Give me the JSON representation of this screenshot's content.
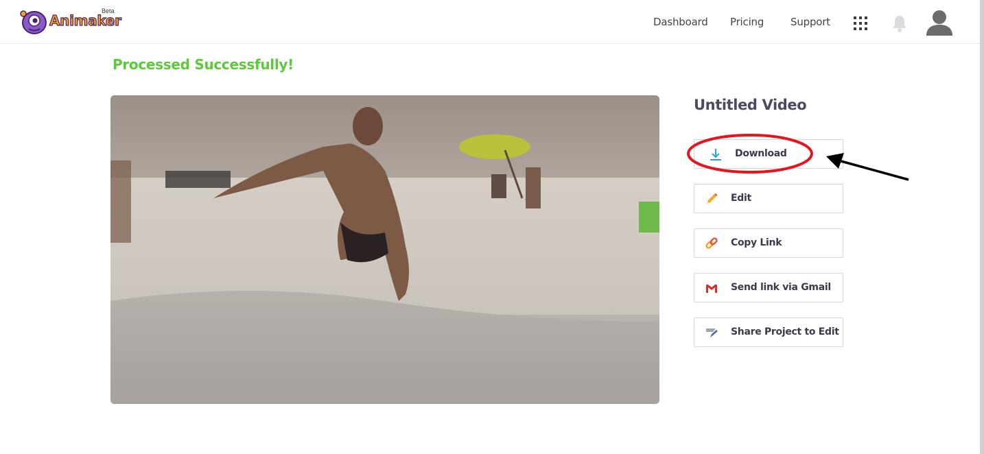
{
  "header": {
    "logo_text": "Animaker",
    "logo_badge": "Beta",
    "nav": [
      {
        "label": "Dashboard"
      },
      {
        "label": "Pricing"
      },
      {
        "label": "Support"
      }
    ],
    "icons": [
      "apps-grid-icon",
      "bell-icon",
      "user-avatar-icon"
    ]
  },
  "main": {
    "status_text": "Processed Successfully!",
    "video_title": "Untitled Video",
    "actions": [
      {
        "label": "Download",
        "icon": "download-icon",
        "icon_color": "#29a3d6"
      },
      {
        "label": "Edit",
        "icon": "pencil-icon",
        "icon_color": "#f5a623"
      },
      {
        "label": "Copy Link",
        "icon": "link-icon",
        "icon_color": "#f5a623"
      },
      {
        "label": "Send link via Gmail",
        "icon": "gmail-icon",
        "icon_color": "#d93025"
      },
      {
        "label": "Share Project to Edit",
        "icon": "share-project-icon",
        "icon_color": "#4a6fa5"
      }
    ]
  },
  "colors": {
    "success": "#5cc93b",
    "annotation_circle": "#e8141b",
    "annotation_arrow": "#000000",
    "text_dark": "#3a3a4e"
  }
}
